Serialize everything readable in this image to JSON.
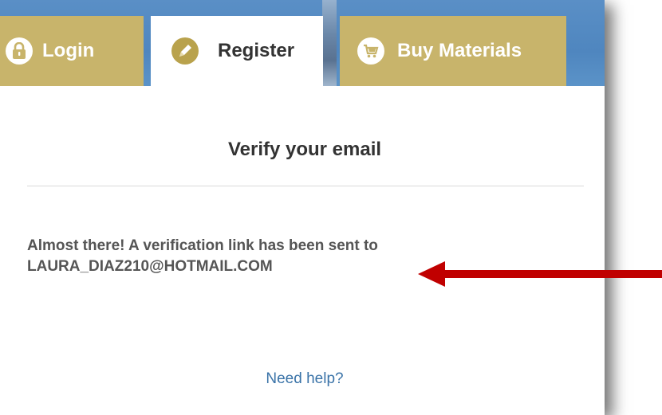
{
  "tabs": [
    {
      "label": "Login",
      "icon": "lock-icon"
    },
    {
      "label": "Register",
      "icon": "pencil-icon"
    },
    {
      "label": "Buy Materials",
      "icon": "shopping-cart-icon"
    }
  ],
  "page": {
    "title": "Verify your email",
    "message_line1": "Almost there! A verification link has been sent to",
    "email": "LAURA_DIAZ210@HOTMAIL.COM",
    "help_link": "Need help?"
  },
  "colors": {
    "tab_gold": "#c8b46b",
    "register_icon_gold": "#b9a24c",
    "header_blue": "#4f86bf",
    "link_blue": "#3a73a8",
    "arrow_red": "#c00000"
  }
}
